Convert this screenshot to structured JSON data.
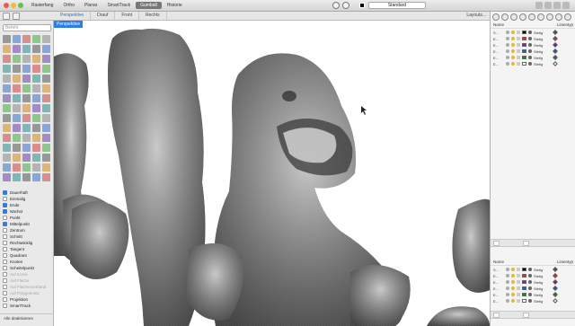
{
  "toolbar": {
    "tabs": [
      {
        "label": "Rasterfang",
        "active": false
      },
      {
        "label": "Ortho",
        "active": false
      },
      {
        "label": "Planar",
        "active": false
      },
      {
        "label": "SmartTrack",
        "active": false
      },
      {
        "label": "Gumball",
        "active": true
      },
      {
        "label": "Historie",
        "active": false
      }
    ],
    "layer_dropdown": "Standard"
  },
  "views": {
    "tabs": [
      {
        "label": "Perspektive",
        "active": true
      },
      {
        "label": "Drauf",
        "active": false
      },
      {
        "label": "Front",
        "active": false
      },
      {
        "label": "Rechts",
        "active": false
      }
    ],
    "layouts_label": "Layouts..."
  },
  "viewport": {
    "label": "Perspektive"
  },
  "left": {
    "command_placeholder": "Befehl",
    "osnap_items": [
      {
        "label": "Dauerhaft",
        "checked": true,
        "disabled": false
      },
      {
        "label": "Einmalig",
        "checked": false,
        "disabled": false
      },
      {
        "label": "Ende",
        "checked": true,
        "disabled": false
      },
      {
        "label": "Nächst",
        "checked": true,
        "disabled": false
      },
      {
        "label": "Punkt",
        "checked": false,
        "disabled": false
      },
      {
        "label": "Mittelpunkt",
        "checked": true,
        "disabled": false
      },
      {
        "label": "Zentrum",
        "checked": false,
        "disabled": false
      },
      {
        "label": "Schnitt",
        "checked": false,
        "disabled": false
      },
      {
        "label": "Rechtwinklig",
        "checked": false,
        "disabled": false
      },
      {
        "label": "Tangent",
        "checked": false,
        "disabled": false
      },
      {
        "label": "Quadrant",
        "checked": false,
        "disabled": false
      },
      {
        "label": "Knoten",
        "checked": false,
        "disabled": false
      },
      {
        "label": "Scheitelpunkt",
        "checked": false,
        "disabled": false
      },
      {
        "label": "Auf Kurve",
        "checked": false,
        "disabled": true
      },
      {
        "label": "Auf Fläche",
        "checked": false,
        "disabled": true
      },
      {
        "label": "Auf Flächenverband",
        "checked": false,
        "disabled": true
      },
      {
        "label": "Auf Polygonnetz",
        "checked": false,
        "disabled": true
      },
      {
        "label": "Projektion",
        "checked": false,
        "disabled": false
      },
      {
        "label": "SmartTrack",
        "checked": false,
        "disabled": false
      }
    ],
    "status": "Alle deaktivieren"
  },
  "layers_top": {
    "name_header": "Name",
    "linetype_header": "Linientyp",
    "rows": [
      {
        "name": "S...",
        "linetype": "Stetig",
        "swatch": "#000000",
        "marker": "#555555"
      },
      {
        "name": "E...",
        "linetype": "Stetig",
        "swatch": "#d32f2f",
        "marker": "#d32f2f"
      },
      {
        "name": "E...",
        "linetype": "Stetig",
        "swatch": "#7b1fa2",
        "marker": "#7b1fa2"
      },
      {
        "name": "E...",
        "linetype": "Stetig",
        "swatch": "#1565c0",
        "marker": "#1565c0"
      },
      {
        "name": "E...",
        "linetype": "Stetig",
        "swatch": "#2e7d32",
        "marker": "#2e7d32"
      },
      {
        "name": "E...",
        "linetype": "Stetig",
        "swatch": "#ffffff",
        "marker": "#ffffff"
      }
    ]
  },
  "layers_bottom": {
    "name_header": "Name",
    "linetype_header": "Linientyp",
    "rows": [
      {
        "name": "S...",
        "linetype": "Stetig",
        "swatch": "#000000",
        "marker": "#555555"
      },
      {
        "name": "E...",
        "linetype": "Stetig",
        "swatch": "#d32f2f",
        "marker": "#d32f2f"
      },
      {
        "name": "E...",
        "linetype": "Stetig",
        "swatch": "#7b1fa2",
        "marker": "#7b1fa2"
      },
      {
        "name": "E...",
        "linetype": "Stetig",
        "swatch": "#1565c0",
        "marker": "#1565c0"
      },
      {
        "name": "E...",
        "linetype": "Stetig",
        "swatch": "#2e7d32",
        "marker": "#2e7d32"
      },
      {
        "name": "E...",
        "linetype": "Stetig",
        "swatch": "#ffffff",
        "marker": "#ffffff"
      }
    ]
  },
  "colors": {
    "accent": "#2f7de1",
    "active_tab": "#777777"
  }
}
